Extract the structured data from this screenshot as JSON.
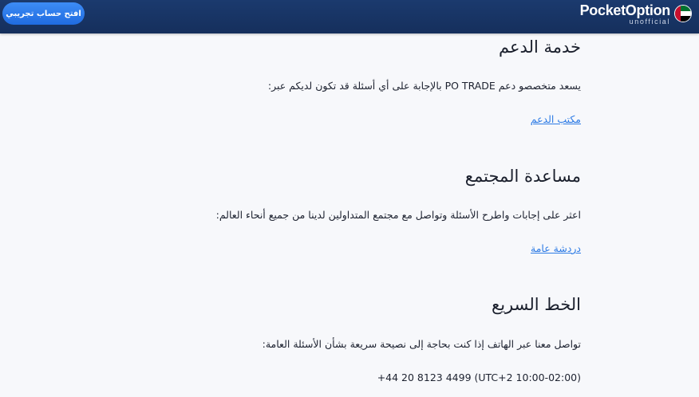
{
  "header": {
    "cta_label": "افتح حساب تجريبي",
    "brand_name": "PocketOption",
    "brand_sub": "unofficial",
    "flag_icon": "uae-flag-icon"
  },
  "sections": [
    {
      "title": "خدمة الدعم",
      "text": "يسعد متخصصو دعم PO TRADE بالإجابة على أي أسئلة قد تكون لديكم عبر:",
      "link": "مكتب الدعم"
    },
    {
      "title": "مساعدة المجتمع",
      "text": "اعثر على إجابات واطرح الأسئلة وتواصل مع مجتمع المتداولين لدينا من جميع أنحاء العالم:",
      "link": "دردشة عامة"
    },
    {
      "title": "الخط السريع",
      "text": "تواصل معنا عبر الهاتف إذا كنت بحاجة إلى نصيحة سريعة بشأن الأسئلة العامة:",
      "phone": "+44 20 8123 4499 (UTC+2 10:00-02:00)"
    }
  ],
  "colors": {
    "header_bg": "#152f5c",
    "cta_bg": "#1f6be0",
    "link": "#2d7be5",
    "page_bg": "#f7f8fb"
  }
}
